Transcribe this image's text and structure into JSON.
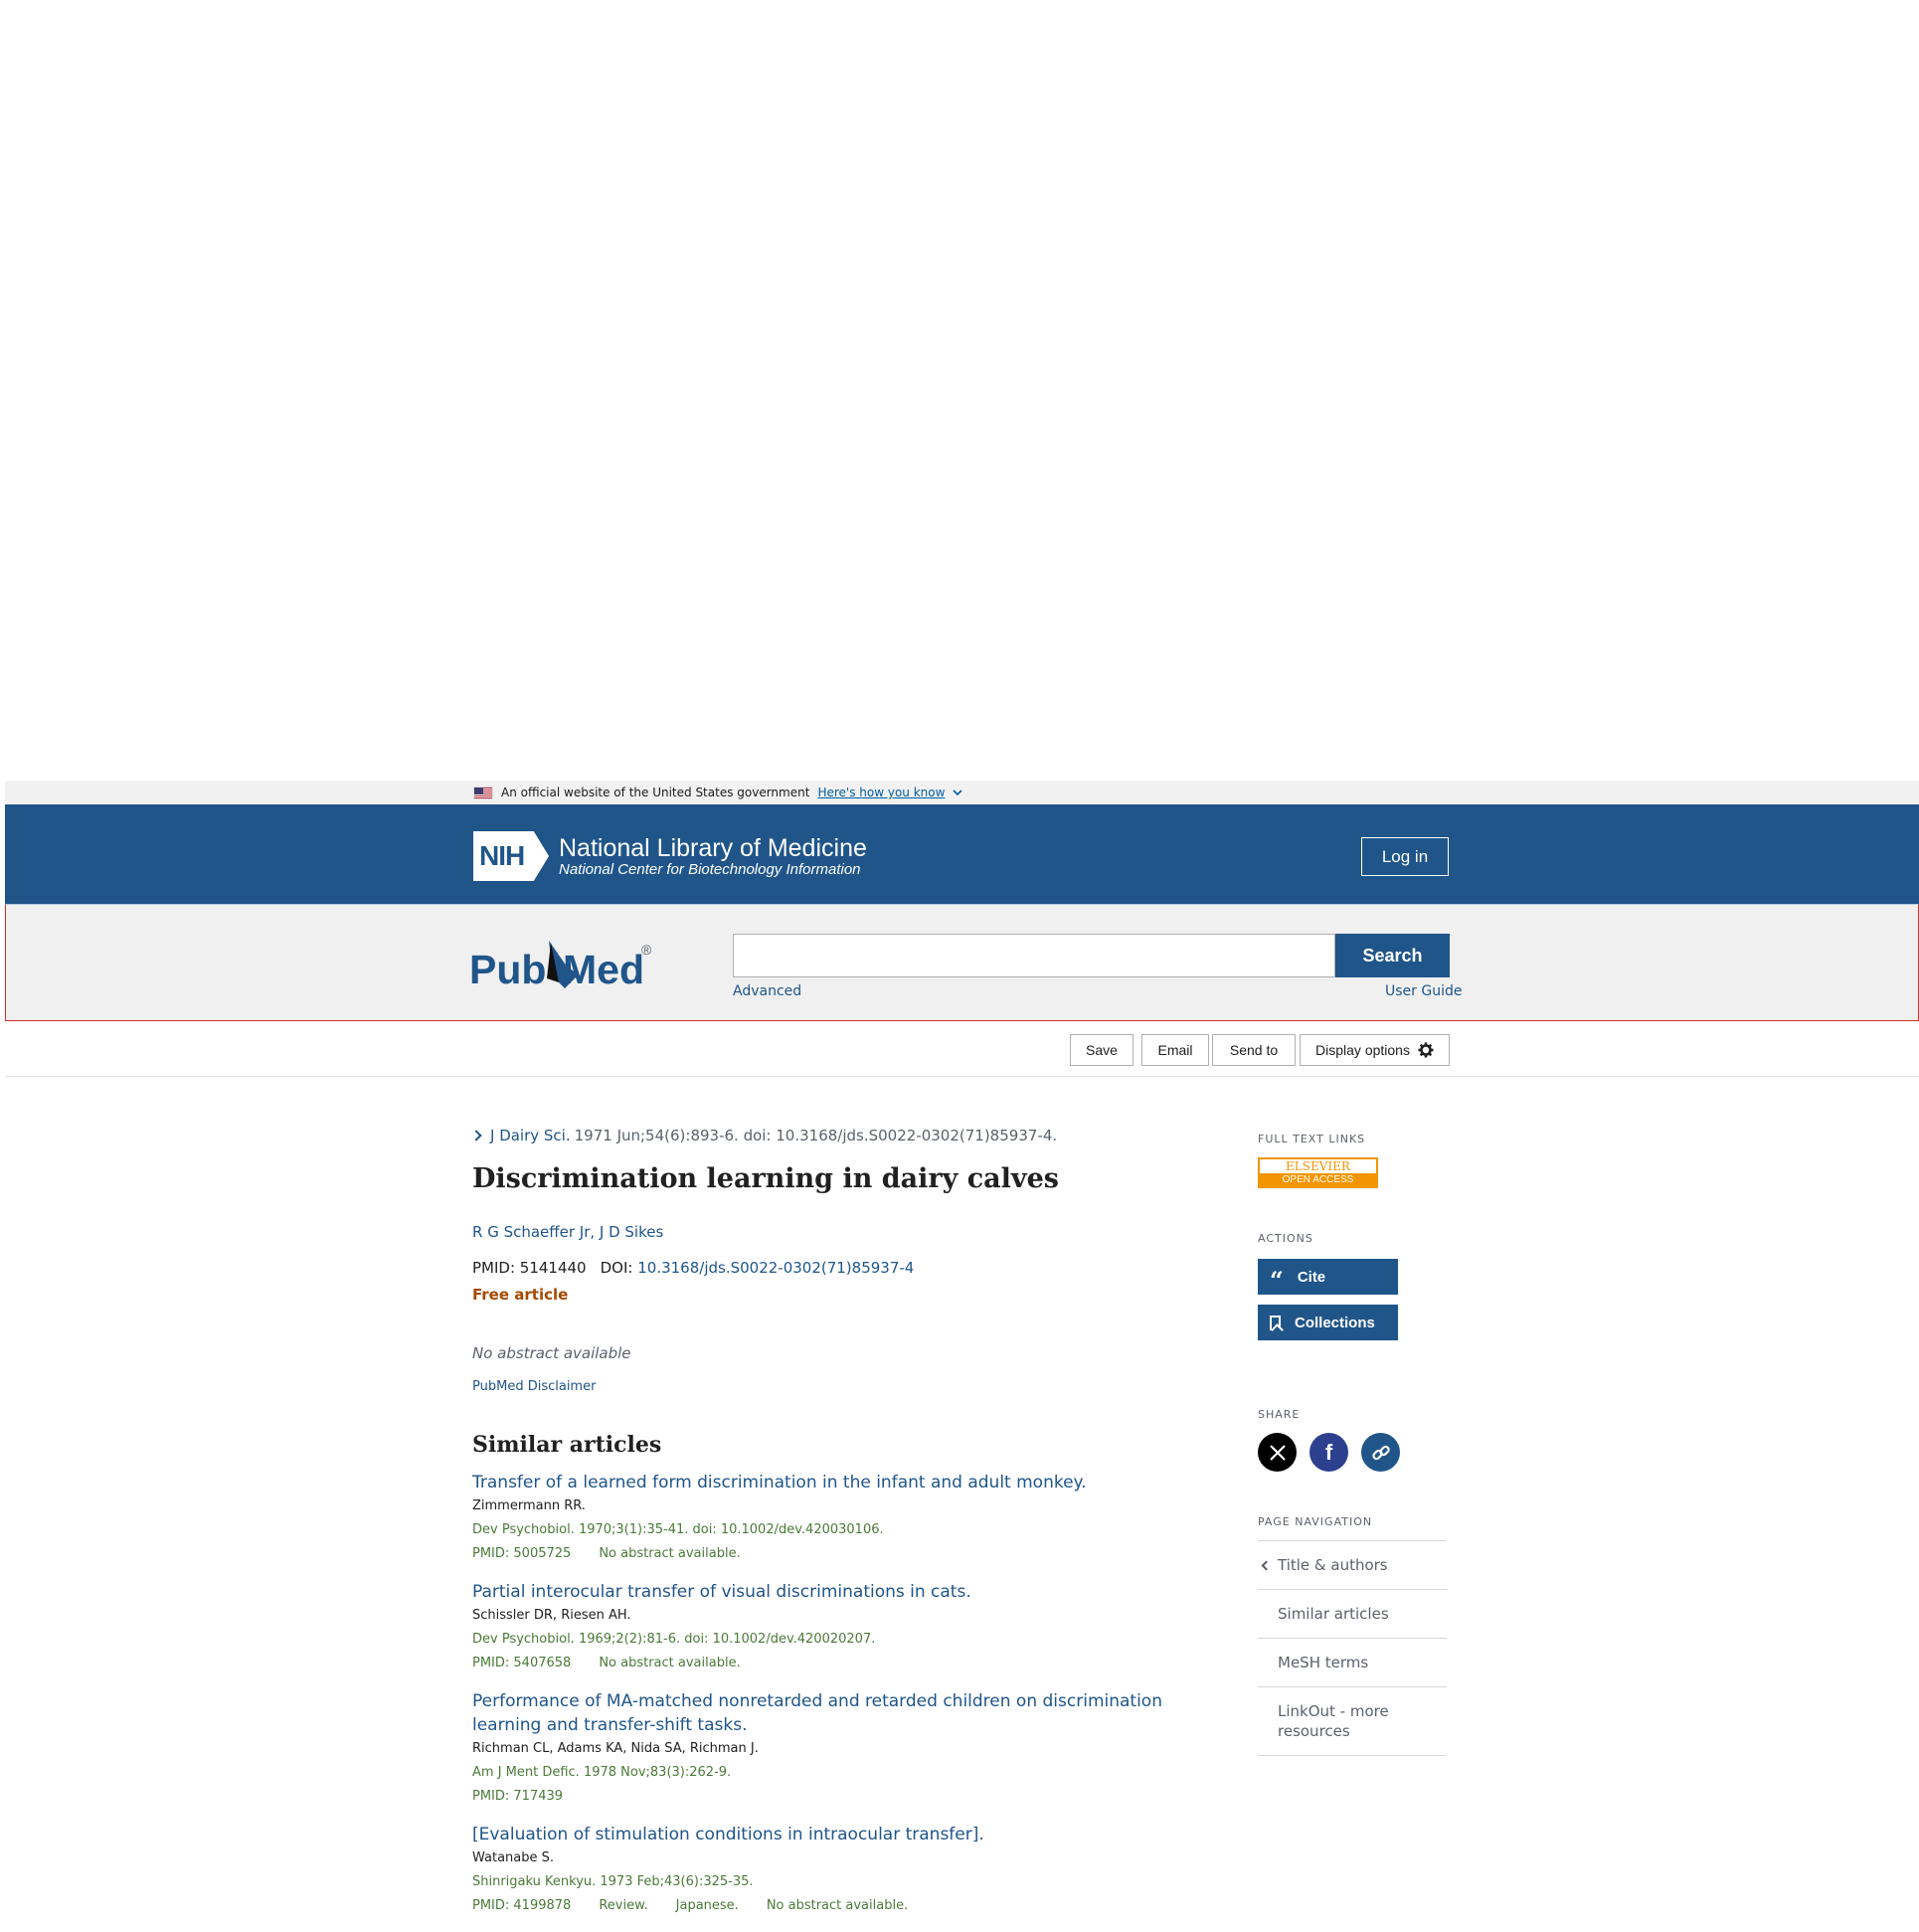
{
  "gov_banner": {
    "text": "An official website of the United States government",
    "link": "Here's how you know"
  },
  "nih_header": {
    "logo_mark": "NIH",
    "title": "National Library of Medicine",
    "subtitle": "National Center for Biotechnology Information",
    "login_label": "Log in"
  },
  "search": {
    "logo_text_pub": "Pub",
    "logo_text_med": "Med",
    "logo_reg": "®",
    "value": "",
    "button_label": "Search",
    "advanced_label": "Advanced",
    "user_guide_label": "User Guide"
  },
  "toolbar": {
    "save_label": "Save",
    "email_label": "Email",
    "send_to_label": "Send to",
    "display_options_label": "Display options"
  },
  "article": {
    "journal": "J Dairy Sci.",
    "citation": "1971 Jun;54(6):893-6. doi: 10.3168/jds.S0022-0302(71)85937-4.",
    "title": "Discrimination learning in dairy calves",
    "authors": "R G Schaeffer Jr, J D Sikes",
    "pmid_label": "PMID:",
    "pmid": "5141440",
    "doi_label": "DOI:",
    "doi": "10.3168/jds.S0022-0302(71)85937-4",
    "free_article": "Free article",
    "no_abstract": "No abstract available",
    "disclaimer": "PubMed Disclaimer"
  },
  "similar": {
    "heading": "Similar articles",
    "items": [
      {
        "title": "Transfer of a learned form discrimination in the infant and adult monkey.",
        "authors": "Zimmermann RR.",
        "citation": "Dev Psychobiol. 1970;3(1):35-41. doi: 10.1002/dev.420030106.",
        "pmid": "PMID: 5005725",
        "note1": "No abstract available.",
        "note2": "",
        "note3": ""
      },
      {
        "title": "Partial interocular transfer of visual discriminations in cats.",
        "authors": "Schissler DR, Riesen AH.",
        "citation": "Dev Psychobiol. 1969;2(2):81-6. doi: 10.1002/dev.420020207.",
        "pmid": "PMID: 5407658",
        "note1": "No abstract available.",
        "note2": "",
        "note3": ""
      },
      {
        "title": "Performance of MA-matched nonretarded and retarded children on discrimination learning and transfer-shift tasks.",
        "authors": "Richman CL, Adams KA, Nida SA, Richman J.",
        "citation": "Am J Ment Defic. 1978 Nov;83(3):262-9.",
        "pmid": "PMID: 717439",
        "note1": "",
        "note2": "",
        "note3": ""
      },
      {
        "title": "[Evaluation of stimulation conditions in intraocular transfer].",
        "authors": "Watanabe S.",
        "citation": "Shinrigaku Kenkyu. 1973 Feb;43(6):325-35.",
        "pmid": "PMID: 4199878",
        "note1": "Review.",
        "note2": "Japanese.",
        "note3": "No abstract available."
      }
    ]
  },
  "sidebar": {
    "full_text_heading": "FULL TEXT LINKS",
    "elsevier_top": "ELSEVIER",
    "elsevier_bottom": "OPEN ACCESS",
    "actions_heading": "ACTIONS",
    "cite_label": "Cite",
    "collections_label": "Collections",
    "share_heading": "SHARE",
    "page_nav_heading": "PAGE NAVIGATION",
    "page_nav": [
      "Title & authors",
      "Similar articles",
      "MeSH terms",
      "LinkOut - more resources"
    ]
  },
  "colors": {
    "brand_blue": "#20558a",
    "free_article": "#a54a00",
    "elsevier_orange": "#f29500"
  }
}
